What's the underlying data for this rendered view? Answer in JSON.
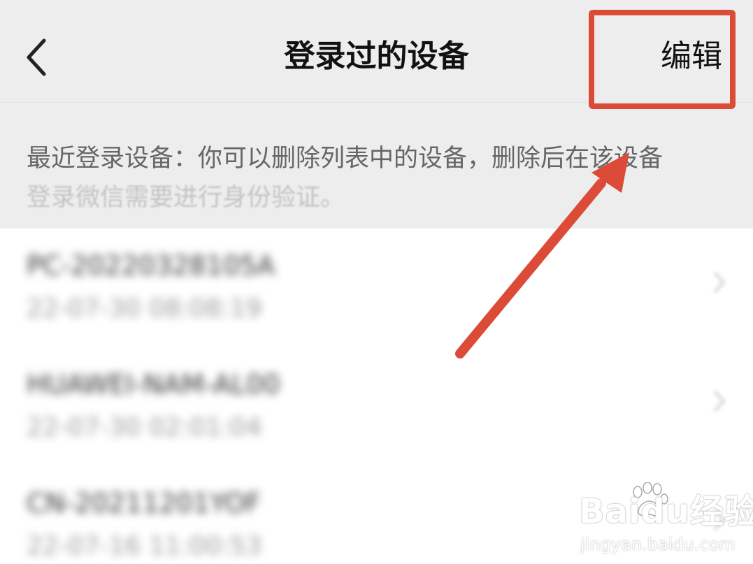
{
  "nav": {
    "title": "登录过的设备",
    "edit_label": "编辑"
  },
  "info": {
    "text_primary": "最近登录设备：你可以删除列表中的设备，删除后在该设备",
    "text_secondary": "登录微信需要进行身份验证。"
  },
  "devices": [
    {
      "name": "PC-20220328105A",
      "time": "22-07-30 08:08:19"
    },
    {
      "name": "HUAWEI-NAM-AL00",
      "time": "22-07-30 02:01:04"
    },
    {
      "name": "CN-20211201YOF",
      "time": "22-07-16 11:00:53"
    }
  ],
  "watermark": {
    "brand": "Baidu经验",
    "url": "jingyan.baidu.com"
  },
  "colors": {
    "background": "#ededed",
    "list_background": "#ffffff",
    "annotation_red": "#dc4b38",
    "title_text": "#111111",
    "info_text": "#666666"
  },
  "icons": {
    "back": "chevron-left-icon",
    "row_chevron": "chevron-right-icon"
  }
}
